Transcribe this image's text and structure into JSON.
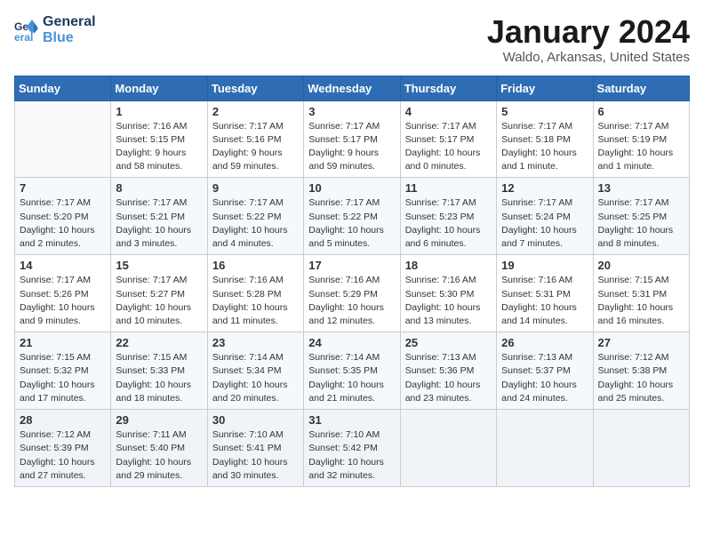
{
  "logo": {
    "text_general": "General",
    "text_blue": "Blue"
  },
  "header": {
    "title": "January 2024",
    "subtitle": "Waldo, Arkansas, United States"
  },
  "weekdays": [
    "Sunday",
    "Monday",
    "Tuesday",
    "Wednesday",
    "Thursday",
    "Friday",
    "Saturday"
  ],
  "weeks": [
    [
      {
        "day": "",
        "info": ""
      },
      {
        "day": "1",
        "info": "Sunrise: 7:16 AM\nSunset: 5:15 PM\nDaylight: 9 hours\nand 58 minutes."
      },
      {
        "day": "2",
        "info": "Sunrise: 7:17 AM\nSunset: 5:16 PM\nDaylight: 9 hours\nand 59 minutes."
      },
      {
        "day": "3",
        "info": "Sunrise: 7:17 AM\nSunset: 5:17 PM\nDaylight: 9 hours\nand 59 minutes."
      },
      {
        "day": "4",
        "info": "Sunrise: 7:17 AM\nSunset: 5:17 PM\nDaylight: 10 hours\nand 0 minutes."
      },
      {
        "day": "5",
        "info": "Sunrise: 7:17 AM\nSunset: 5:18 PM\nDaylight: 10 hours\nand 1 minute."
      },
      {
        "day": "6",
        "info": "Sunrise: 7:17 AM\nSunset: 5:19 PM\nDaylight: 10 hours\nand 1 minute."
      }
    ],
    [
      {
        "day": "7",
        "info": "Sunrise: 7:17 AM\nSunset: 5:20 PM\nDaylight: 10 hours\nand 2 minutes."
      },
      {
        "day": "8",
        "info": "Sunrise: 7:17 AM\nSunset: 5:21 PM\nDaylight: 10 hours\nand 3 minutes."
      },
      {
        "day": "9",
        "info": "Sunrise: 7:17 AM\nSunset: 5:22 PM\nDaylight: 10 hours\nand 4 minutes."
      },
      {
        "day": "10",
        "info": "Sunrise: 7:17 AM\nSunset: 5:22 PM\nDaylight: 10 hours\nand 5 minutes."
      },
      {
        "day": "11",
        "info": "Sunrise: 7:17 AM\nSunset: 5:23 PM\nDaylight: 10 hours\nand 6 minutes."
      },
      {
        "day": "12",
        "info": "Sunrise: 7:17 AM\nSunset: 5:24 PM\nDaylight: 10 hours\nand 7 minutes."
      },
      {
        "day": "13",
        "info": "Sunrise: 7:17 AM\nSunset: 5:25 PM\nDaylight: 10 hours\nand 8 minutes."
      }
    ],
    [
      {
        "day": "14",
        "info": "Sunrise: 7:17 AM\nSunset: 5:26 PM\nDaylight: 10 hours\nand 9 minutes."
      },
      {
        "day": "15",
        "info": "Sunrise: 7:17 AM\nSunset: 5:27 PM\nDaylight: 10 hours\nand 10 minutes."
      },
      {
        "day": "16",
        "info": "Sunrise: 7:16 AM\nSunset: 5:28 PM\nDaylight: 10 hours\nand 11 minutes."
      },
      {
        "day": "17",
        "info": "Sunrise: 7:16 AM\nSunset: 5:29 PM\nDaylight: 10 hours\nand 12 minutes."
      },
      {
        "day": "18",
        "info": "Sunrise: 7:16 AM\nSunset: 5:30 PM\nDaylight: 10 hours\nand 13 minutes."
      },
      {
        "day": "19",
        "info": "Sunrise: 7:16 AM\nSunset: 5:31 PM\nDaylight: 10 hours\nand 14 minutes."
      },
      {
        "day": "20",
        "info": "Sunrise: 7:15 AM\nSunset: 5:31 PM\nDaylight: 10 hours\nand 16 minutes."
      }
    ],
    [
      {
        "day": "21",
        "info": "Sunrise: 7:15 AM\nSunset: 5:32 PM\nDaylight: 10 hours\nand 17 minutes."
      },
      {
        "day": "22",
        "info": "Sunrise: 7:15 AM\nSunset: 5:33 PM\nDaylight: 10 hours\nand 18 minutes."
      },
      {
        "day": "23",
        "info": "Sunrise: 7:14 AM\nSunset: 5:34 PM\nDaylight: 10 hours\nand 20 minutes."
      },
      {
        "day": "24",
        "info": "Sunrise: 7:14 AM\nSunset: 5:35 PM\nDaylight: 10 hours\nand 21 minutes."
      },
      {
        "day": "25",
        "info": "Sunrise: 7:13 AM\nSunset: 5:36 PM\nDaylight: 10 hours\nand 23 minutes."
      },
      {
        "day": "26",
        "info": "Sunrise: 7:13 AM\nSunset: 5:37 PM\nDaylight: 10 hours\nand 24 minutes."
      },
      {
        "day": "27",
        "info": "Sunrise: 7:12 AM\nSunset: 5:38 PM\nDaylight: 10 hours\nand 25 minutes."
      }
    ],
    [
      {
        "day": "28",
        "info": "Sunrise: 7:12 AM\nSunset: 5:39 PM\nDaylight: 10 hours\nand 27 minutes."
      },
      {
        "day": "29",
        "info": "Sunrise: 7:11 AM\nSunset: 5:40 PM\nDaylight: 10 hours\nand 29 minutes."
      },
      {
        "day": "30",
        "info": "Sunrise: 7:10 AM\nSunset: 5:41 PM\nDaylight: 10 hours\nand 30 minutes."
      },
      {
        "day": "31",
        "info": "Sunrise: 7:10 AM\nSunset: 5:42 PM\nDaylight: 10 hours\nand 32 minutes."
      },
      {
        "day": "",
        "info": ""
      },
      {
        "day": "",
        "info": ""
      },
      {
        "day": "",
        "info": ""
      }
    ]
  ]
}
